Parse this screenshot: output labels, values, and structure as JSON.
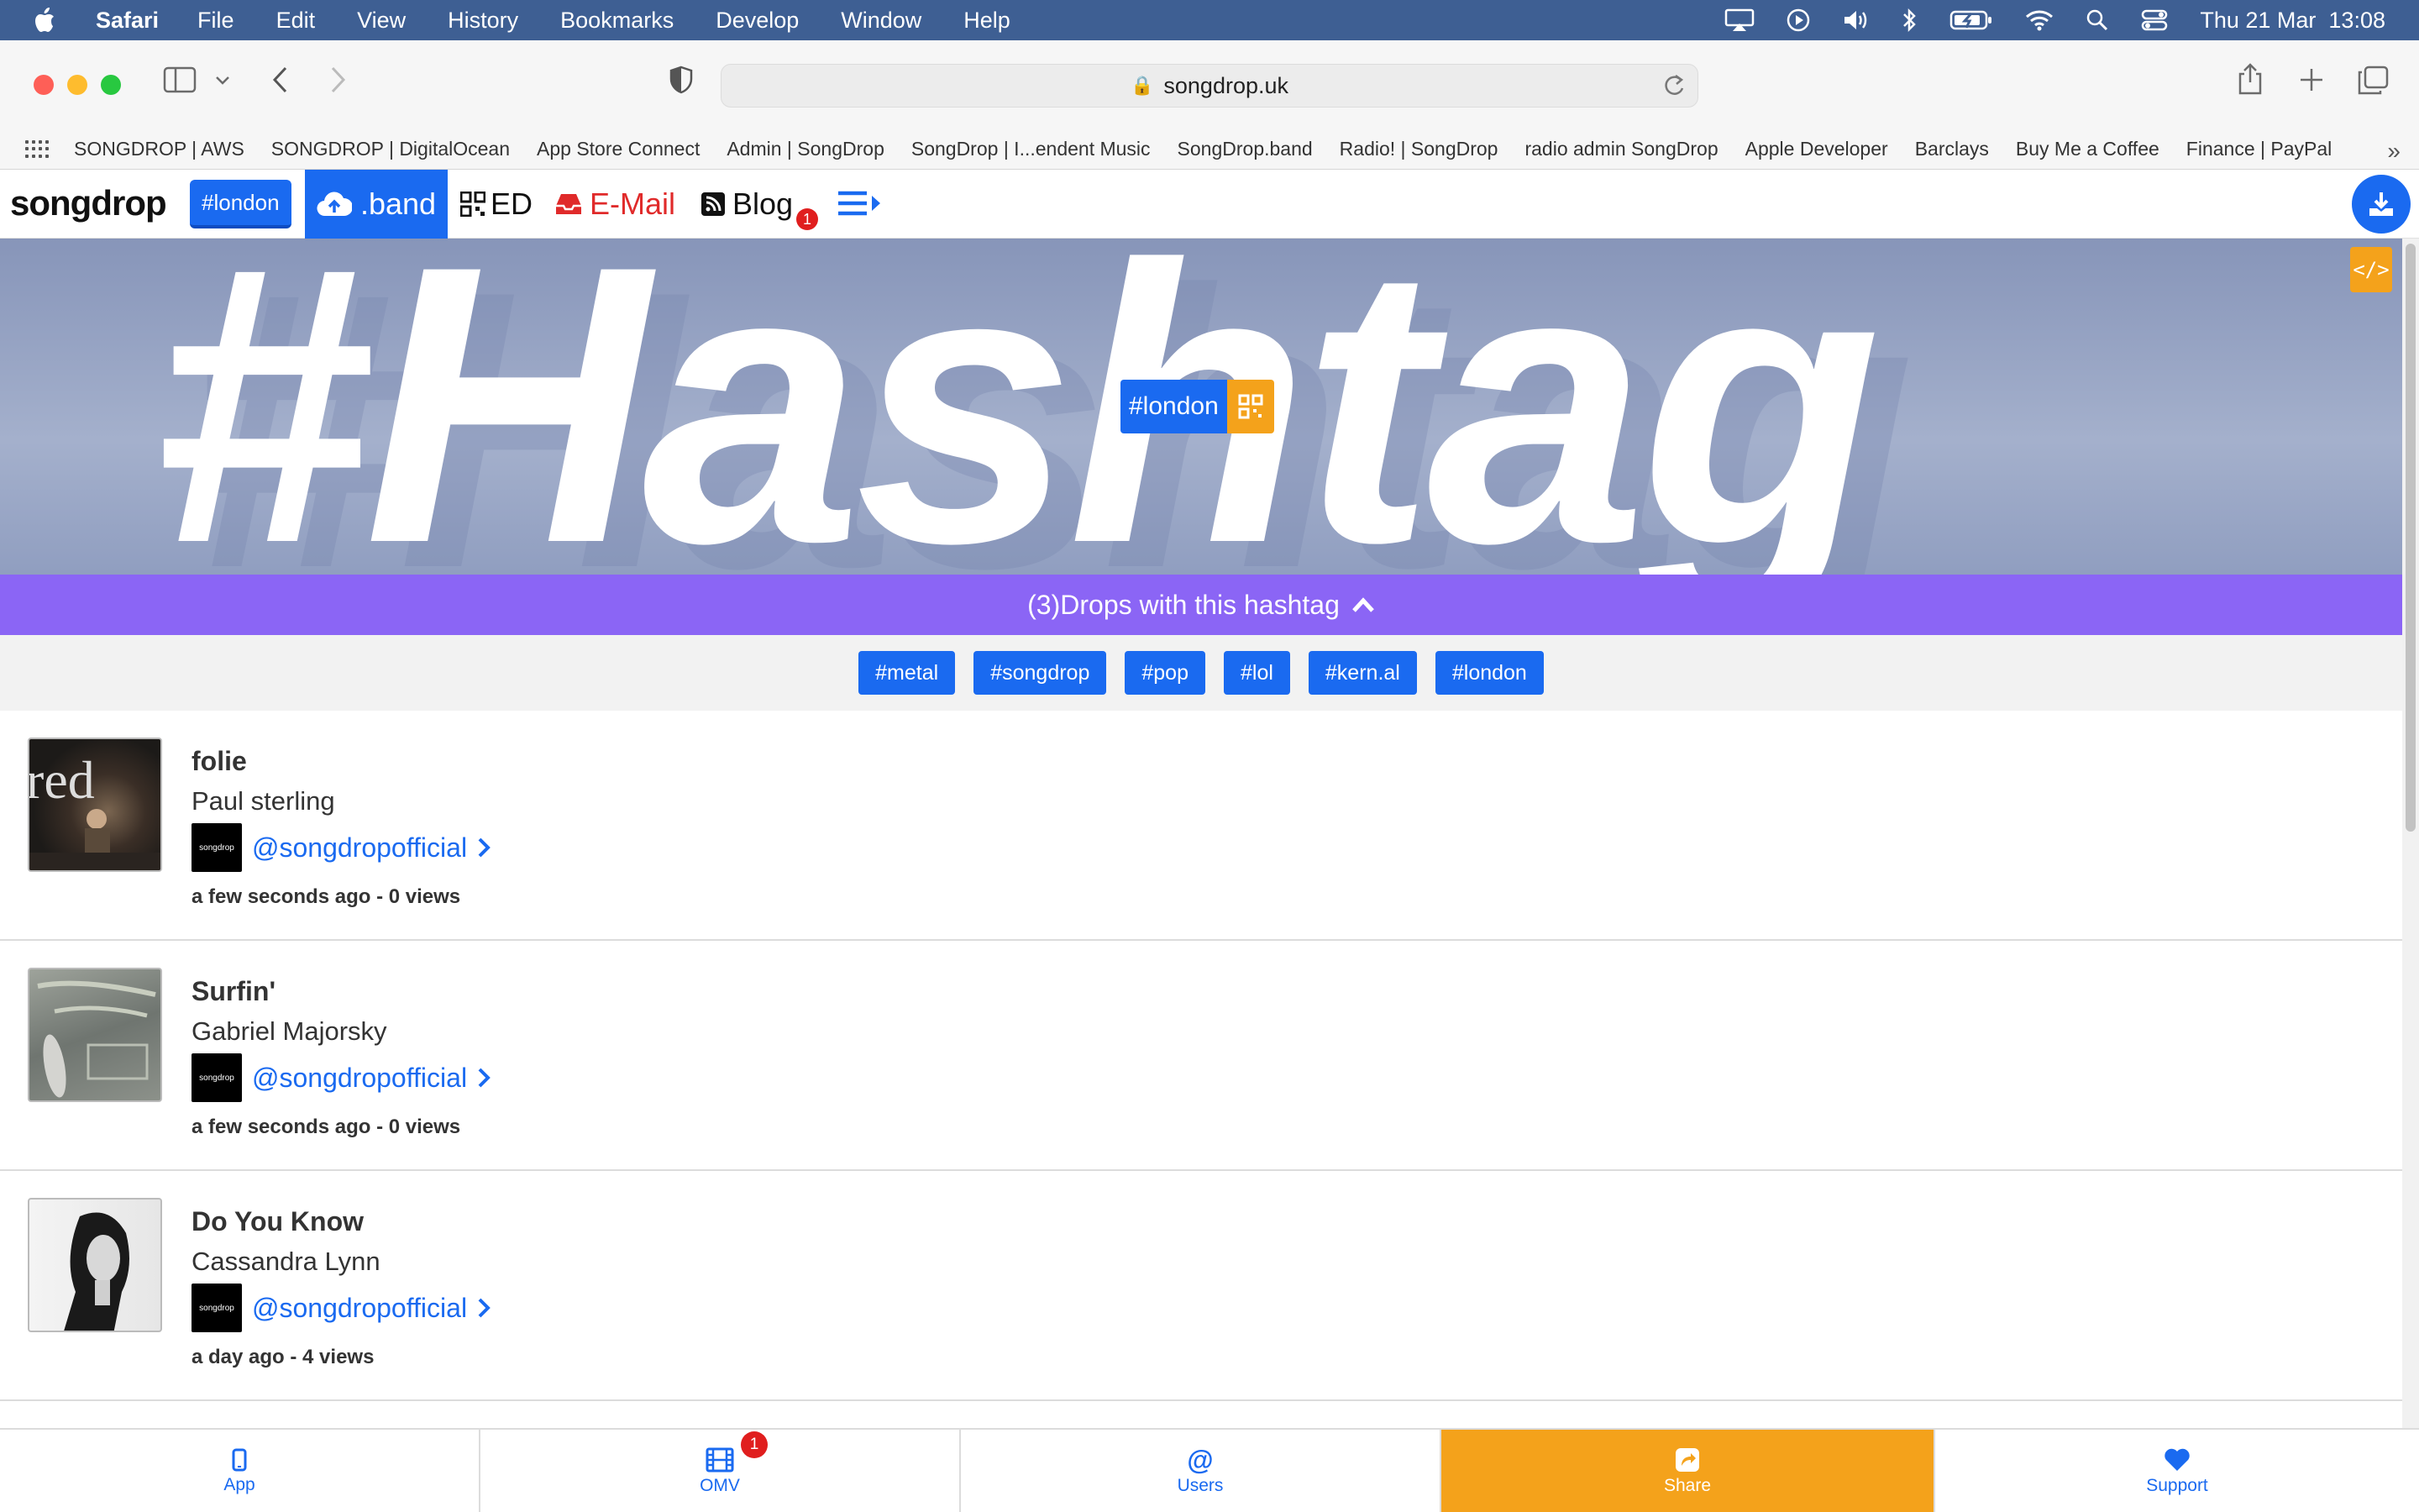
{
  "menubar": {
    "app": "Safari",
    "items": [
      "File",
      "Edit",
      "View",
      "History",
      "Bookmarks",
      "Develop",
      "Window",
      "Help"
    ],
    "datetime": "Thu 21 Mar  13:08"
  },
  "browser": {
    "url": "songdrop.uk",
    "favorites": [
      "SONGDROP | AWS",
      "SONGDROP | DigitalOcean",
      "App Store Connect",
      "Admin | SongDrop",
      "SongDrop | I...endent Music",
      "SongDrop.band",
      "Radio! | SongDrop",
      "radio admin SongDrop",
      "Apple Developer",
      "Barclays",
      "Buy Me a Coffee",
      "Finance | PayPal"
    ]
  },
  "nav": {
    "logo": "songdrop",
    "hashtag": "#london",
    "band": ".band",
    "ed": "ED",
    "email": "E-Mail",
    "blog": "Blog",
    "blog_badge": "1"
  },
  "hero": {
    "bg_text": "#Hashtag",
    "tag": "#london"
  },
  "drops_bar": "(3)Drops with this hashtag",
  "hashtags": [
    "#metal",
    "#songdrop",
    "#pop",
    "#lol",
    "#kern.al",
    "#london"
  ],
  "drops": [
    {
      "title": "folie",
      "artist": "Paul sterling",
      "user": "@songdropofficial",
      "meta": "a few seconds ago - 0 views"
    },
    {
      "title": "Surfin'",
      "artist": "Gabriel Majorsky",
      "user": "@songdropofficial",
      "meta": "a few seconds ago - 0 views"
    },
    {
      "title": "Do You Know",
      "artist": "Cassandra Lynn",
      "user": "@songdropofficial",
      "meta": "a day ago - 4 views"
    }
  ],
  "avatar_text": "songdrop",
  "bottom_tabs": [
    {
      "label": "App",
      "icon": "phone-icon"
    },
    {
      "label": "OMV",
      "icon": "film-icon",
      "badge": "1"
    },
    {
      "label": "Users",
      "icon": "at-icon"
    },
    {
      "label": "Share",
      "icon": "share-icon"
    },
    {
      "label": "Support",
      "icon": "heart-icon"
    }
  ],
  "colors": {
    "primary": "#1a6af0",
    "accent_orange": "#f4a21b",
    "drops_bar": "#8b65f5",
    "email_red": "#e02a2a"
  }
}
